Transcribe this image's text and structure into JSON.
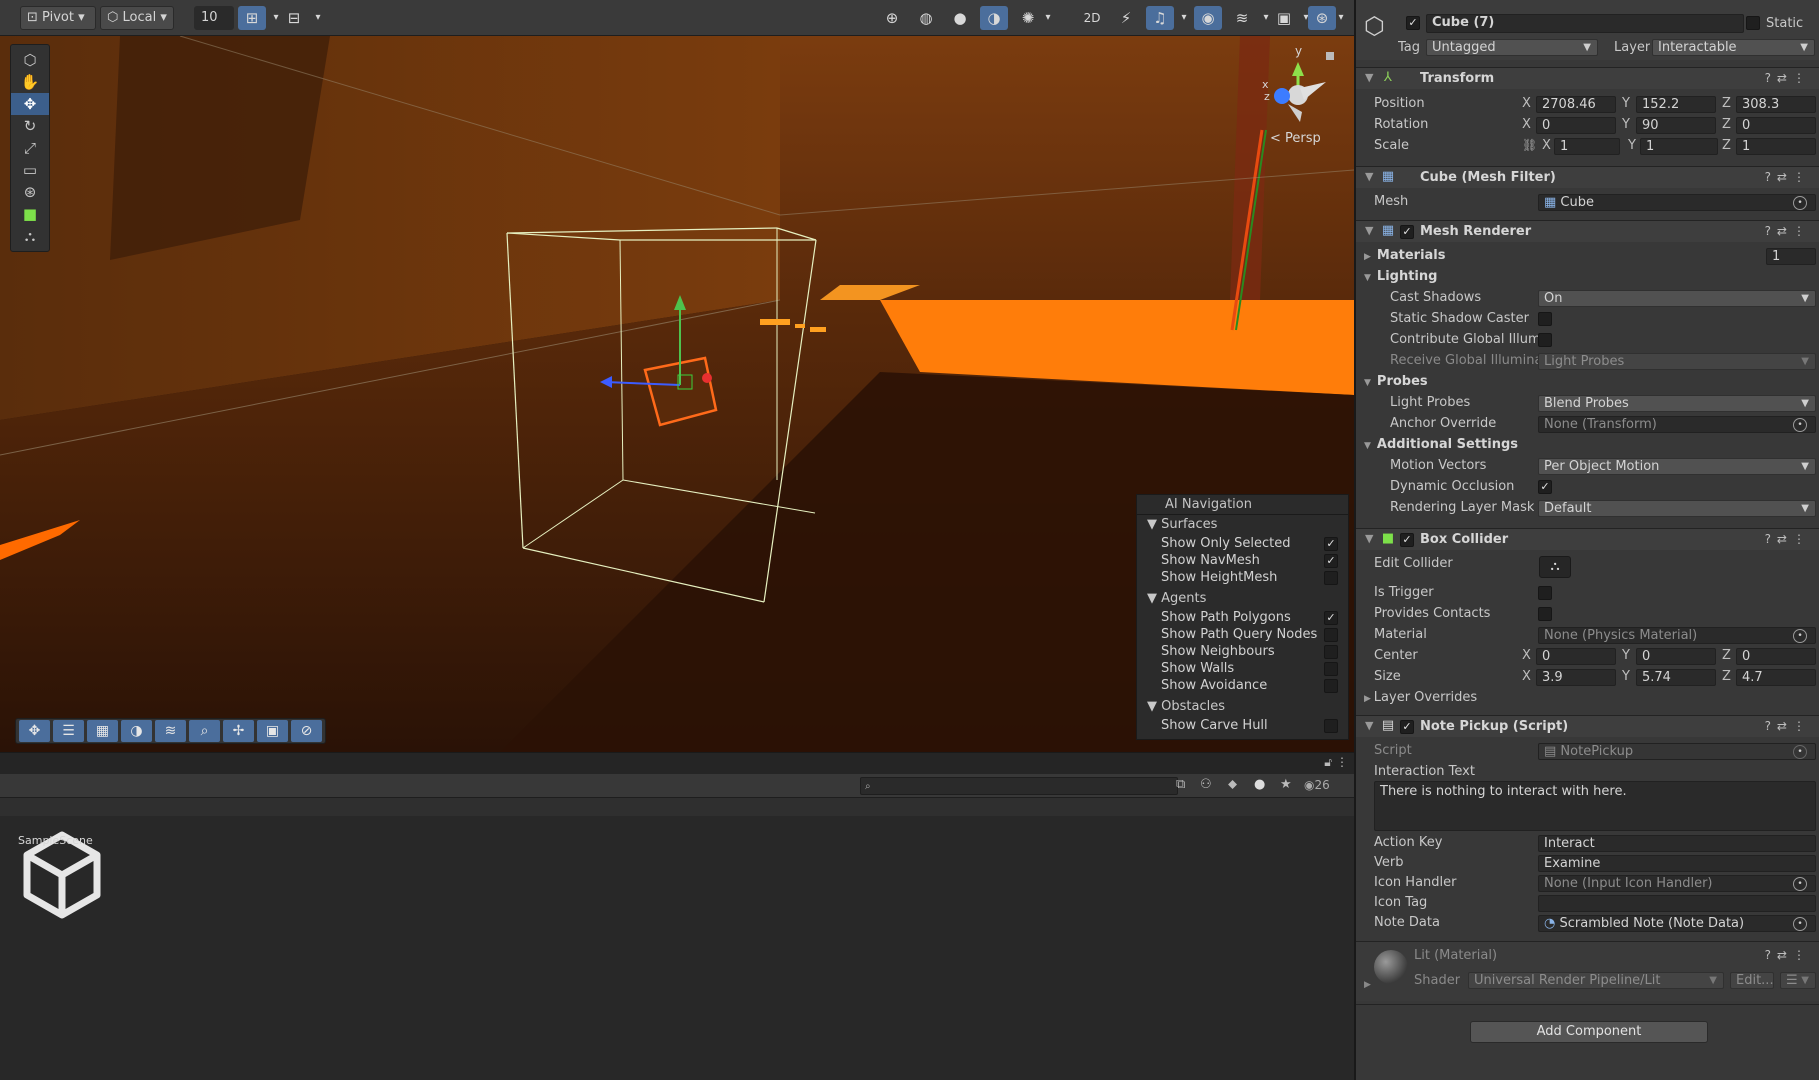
{
  "toolbar": {
    "pivot": "Pivot",
    "local": "Local",
    "grid_size": "10"
  },
  "scene": {
    "persp_label": "Persp",
    "gizmo_y": "y",
    "gizmo_x": "x",
    "gizmo_z": "z"
  },
  "ai_nav": {
    "title": "AI Navigation",
    "surfaces_title": "Surfaces",
    "surfaces": [
      {
        "label": "Show Only Selected",
        "checked": true
      },
      {
        "label": "Show NavMesh",
        "checked": true
      },
      {
        "label": "Show HeightMesh",
        "checked": false
      }
    ],
    "agents_title": "Agents",
    "agents": [
      {
        "label": "Show Path Polygons",
        "checked": true
      },
      {
        "label": "Show Path Query Nodes",
        "checked": false
      },
      {
        "label": "Show Neighbours",
        "checked": false
      },
      {
        "label": "Show Walls",
        "checked": false
      },
      {
        "label": "Show Avoidance",
        "checked": false
      }
    ],
    "obstacles_title": "Obstacles",
    "obstacles": [
      {
        "label": "Show Carve Hull",
        "checked": false
      }
    ]
  },
  "project": {
    "hidden_count": "26",
    "asset_name": "SampleScene"
  },
  "inspector": {
    "object_name": "Cube (7)",
    "static_label": "Static",
    "tag_label": "Tag",
    "tag_value": "Untagged",
    "layer_label": "Layer",
    "layer_value": "Interactable",
    "transform": {
      "title": "Transform",
      "position_label": "Position",
      "rotation_label": "Rotation",
      "scale_label": "Scale",
      "position": {
        "x": "2708.46",
        "y": "152.2",
        "z": "308.3"
      },
      "rotation": {
        "x": "0",
        "y": "90",
        "z": "0"
      },
      "scale": {
        "x": "1",
        "y": "1",
        "z": "1"
      }
    },
    "axis": {
      "x": "X",
      "y": "Y",
      "z": "Z"
    },
    "mesh_filter": {
      "title": "Cube (Mesh Filter)",
      "mesh_label": "Mesh",
      "mesh_value": "Cube"
    },
    "mesh_renderer": {
      "title": "Mesh Renderer",
      "materials_label": "Materials",
      "materials_count": "1",
      "lighting_label": "Lighting",
      "cast_shadows_label": "Cast Shadows",
      "cast_shadows_value": "On",
      "static_shadow_label": "Static Shadow Caster",
      "contribute_gi_label": "Contribute Global Illumina",
      "receive_gi_label": "Receive Global Illuminatic",
      "receive_gi_value": "Light Probes",
      "probes_label": "Probes",
      "light_probes_label": "Light Probes",
      "light_probes_value": "Blend Probes",
      "anchor_override_label": "Anchor Override",
      "anchor_override_value": "None (Transform)",
      "additional_label": "Additional Settings",
      "motion_vectors_label": "Motion Vectors",
      "motion_vectors_value": "Per Object Motion",
      "dynamic_occlusion_label": "Dynamic Occlusion",
      "rendering_layer_label": "Rendering Layer Mask",
      "rendering_layer_value": "Default"
    },
    "box_collider": {
      "title": "Box Collider",
      "edit_collider_label": "Edit Collider",
      "is_trigger_label": "Is Trigger",
      "provides_contacts_label": "Provides Contacts",
      "material_label": "Material",
      "material_value": "None (Physics Material)",
      "center_label": "Center",
      "size_label": "Size",
      "center": {
        "x": "0",
        "y": "0",
        "z": "0"
      },
      "size": {
        "x": "3.9",
        "y": "5.74",
        "z": "4.7"
      },
      "layer_overrides_label": "Layer Overrides"
    },
    "note_pickup": {
      "title": "Note Pickup (Script)",
      "script_label": "Script",
      "script_value": "NotePickup",
      "interaction_text_label": "Interaction Text",
      "interaction_text_value": "There is nothing to interact with here.",
      "action_key_label": "Action Key",
      "action_key_value": "Interact",
      "verb_label": "Verb",
      "verb_value": "Examine",
      "icon_handler_label": "Icon Handler",
      "icon_handler_value": "None (Input Icon Handler)",
      "icon_tag_label": "Icon Tag",
      "icon_tag_value": "",
      "note_data_label": "Note Data",
      "note_data_value": "Scrambled Note (Note Data)"
    },
    "material": {
      "title": "Lit (Material)",
      "shader_label": "Shader",
      "shader_value": "Universal Render Pipeline/Lit",
      "edit_label": "Edit..."
    },
    "add_component": "Add Component"
  }
}
